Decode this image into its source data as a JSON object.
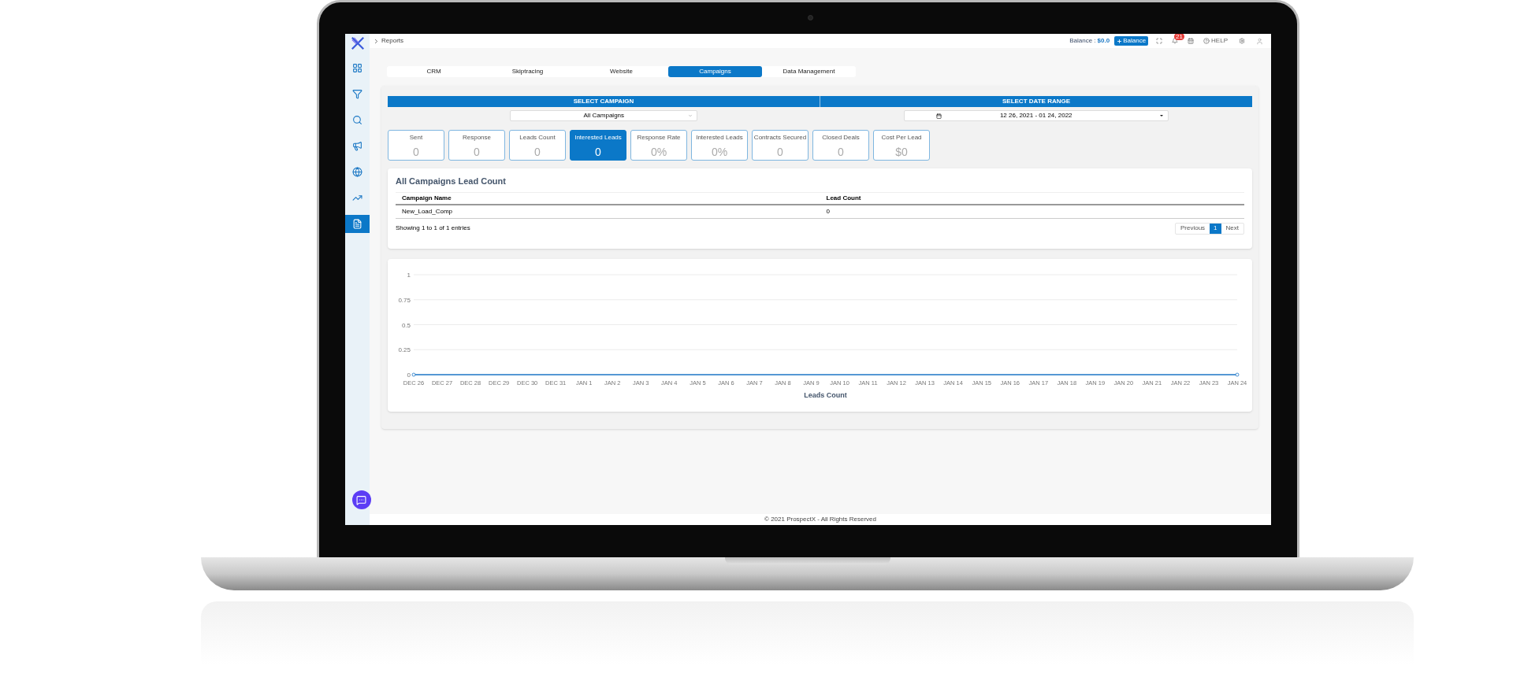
{
  "topbar": {
    "breadcrumb": "Reports",
    "balance_label": "Balance :",
    "balance_value": "$0.0",
    "add_balance": "Balance",
    "notifications": "21",
    "help": "HELP"
  },
  "sidebar": {
    "items": [
      {
        "selected": false
      },
      {
        "selected": false
      },
      {
        "selected": false
      },
      {
        "selected": false
      },
      {
        "selected": false
      },
      {
        "selected": false
      },
      {
        "selected": true
      }
    ]
  },
  "tabs": [
    {
      "label": "CRM",
      "selected": false
    },
    {
      "label": "Skiptracing",
      "selected": false
    },
    {
      "label": "Website",
      "selected": false
    },
    {
      "label": "Campaigns",
      "selected": true
    },
    {
      "label": "Data Management",
      "selected": false
    }
  ],
  "filters": {
    "campaign_header": "SELECT CAMPAIGN",
    "campaign_value": "All Campaigns",
    "date_header": "SELECT DATE RANGE",
    "date_value": "12 26, 2021 - 01 24, 2022"
  },
  "stats": [
    {
      "label": "Sent",
      "value": "0",
      "selected": false
    },
    {
      "label": "Response",
      "value": "0",
      "selected": false
    },
    {
      "label": "Leads Count",
      "value": "0",
      "selected": false
    },
    {
      "label": "Interested Leads",
      "value": "0",
      "selected": true
    },
    {
      "label": "Response Rate",
      "value": "0%",
      "selected": false
    },
    {
      "label": "Interested Leads",
      "value": "0%",
      "selected": false
    },
    {
      "label": "Contracts Secured",
      "value": "0",
      "selected": false
    },
    {
      "label": "Closed Deals",
      "value": "0",
      "selected": false
    },
    {
      "label": "Cost Per Lead",
      "value": "$0",
      "selected": false
    }
  ],
  "table": {
    "title": "All Campaigns Lead Count",
    "columns": [
      "Campaign Name",
      "Lead Count"
    ],
    "rows": [
      [
        "New_Load_Comp",
        "0"
      ]
    ],
    "info": "Showing 1 to 1 of 1 entries",
    "previous": "Previous",
    "next": "Next",
    "pages": [
      {
        "label": "1",
        "selected": true
      }
    ]
  },
  "chart": {
    "chart_data": {
      "type": "line",
      "xlabel": "Leads Count",
      "categories": [
        "DEC 26",
        "DEC 27",
        "DEC 28",
        "DEC 29",
        "DEC 30",
        "DEC 31",
        "JAN 1",
        "JAN 2",
        "JAN 3",
        "JAN 4",
        "JAN 5",
        "JAN 6",
        "JAN 7",
        "JAN 8",
        "JAN 9",
        "JAN 10",
        "JAN 11",
        "JAN 12",
        "JAN 13",
        "JAN 14",
        "JAN 15",
        "JAN 16",
        "JAN 17",
        "JAN 18",
        "JAN 19",
        "JAN 20",
        "JAN 21",
        "JAN 22",
        "JAN 23",
        "JAN 24"
      ],
      "series": [
        {
          "color": "#1f78c8",
          "values": [
            0,
            0,
            0,
            0,
            0,
            0,
            0,
            0,
            0,
            0,
            0,
            0,
            0,
            0,
            0,
            0,
            0,
            0,
            0,
            0,
            0,
            0,
            0,
            0,
            0,
            0,
            0,
            0,
            0,
            0
          ]
        }
      ],
      "grid": true,
      "ylim": [
        0,
        1
      ],
      "yticks": [
        0,
        0.25,
        0.5,
        0.75,
        1
      ]
    }
  },
  "footer": "© 2021 ProspectX - All Rights Reserved"
}
